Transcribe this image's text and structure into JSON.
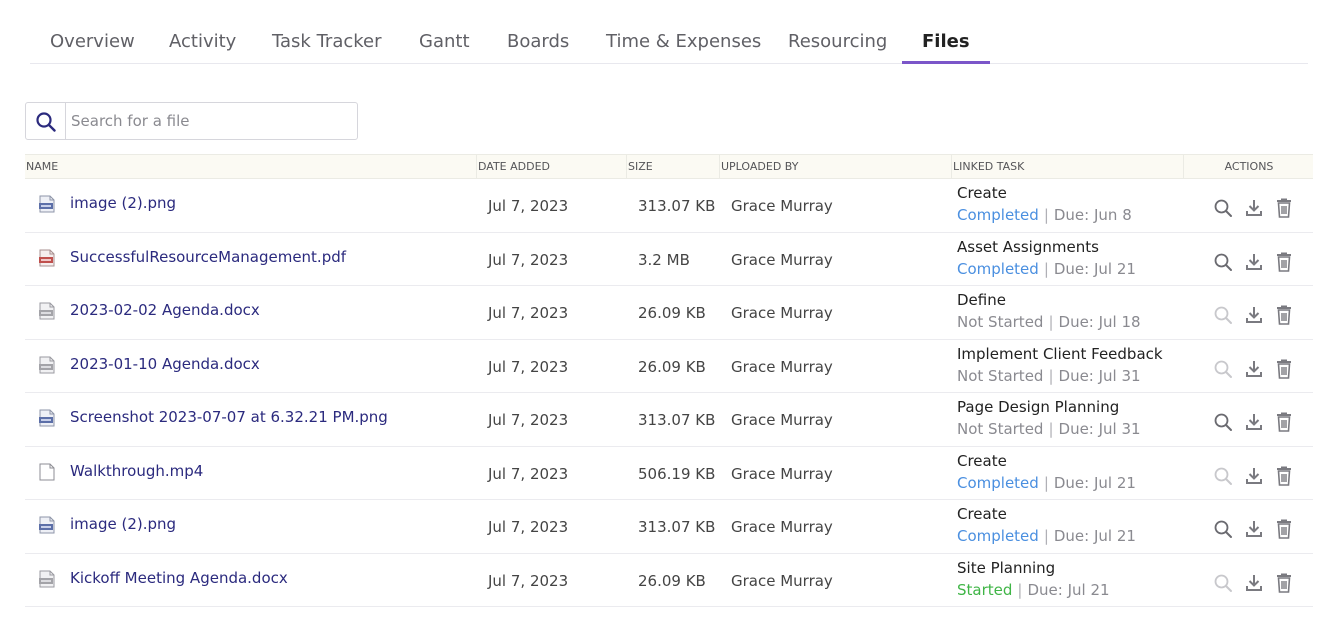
{
  "tabs": [
    {
      "label": "Overview",
      "active": false
    },
    {
      "label": "Activity",
      "active": false
    },
    {
      "label": "Task Tracker",
      "active": false
    },
    {
      "label": "Gantt",
      "active": false
    },
    {
      "label": "Boards",
      "active": false
    },
    {
      "label": "Time & Expenses",
      "active": false
    },
    {
      "label": "Resourcing",
      "active": false
    },
    {
      "label": "Files",
      "active": true
    }
  ],
  "search": {
    "placeholder": "Search for a file",
    "value": ""
  },
  "table": {
    "headers": {
      "name": "NAME",
      "date_added": "DATE ADDED",
      "size": "SIZE",
      "uploaded_by": "UPLOADED BY",
      "linked_task": "LINKED TASK",
      "actions": "ACTIONS"
    },
    "rows": [
      {
        "icon": "png-file-icon",
        "name": "image (2).png",
        "date": "Jul 7, 2023",
        "size": "313.07 KB",
        "uploader": "Grace Murray",
        "task": "Create",
        "status": "Completed",
        "status_kind": "completed",
        "due": "Due: Jun 8",
        "preview_enabled": true
      },
      {
        "icon": "pdf-file-icon",
        "name": "SuccessfulResourceManagement.pdf",
        "date": "Jul 7, 2023",
        "size": "3.2 MB",
        "uploader": "Grace Murray",
        "task": "Asset Assignments",
        "status": "Completed",
        "status_kind": "completed",
        "due": "Due: Jul 21",
        "preview_enabled": true
      },
      {
        "icon": "doc-file-icon",
        "name": "2023-02-02 Agenda.docx",
        "date": "Jul 7, 2023",
        "size": "26.09 KB",
        "uploader": "Grace Murray",
        "task": "Define",
        "status": "Not Started",
        "status_kind": "notstarted",
        "due": "Due: Jul 18",
        "preview_enabled": false
      },
      {
        "icon": "doc-file-icon",
        "name": "2023-01-10 Agenda.docx",
        "date": "Jul 7, 2023",
        "size": "26.09 KB",
        "uploader": "Grace Murray",
        "task": "Implement Client Feedback",
        "status": "Not Started",
        "status_kind": "notstarted",
        "due": "Due: Jul 31",
        "preview_enabled": false
      },
      {
        "icon": "png-file-icon",
        "name": "Screenshot 2023-07-07 at 6.32.21 PM.png",
        "date": "Jul 7, 2023",
        "size": "313.07 KB",
        "uploader": "Grace Murray",
        "task": "Page Design Planning",
        "status": "Not Started",
        "status_kind": "notstarted",
        "due": "Due: Jul 31",
        "preview_enabled": true
      },
      {
        "icon": "blank-file-icon",
        "name": "Walkthrough.mp4",
        "date": "Jul 7, 2023",
        "size": "506.19 KB",
        "uploader": "Grace Murray",
        "task": "Create",
        "status": "Completed",
        "status_kind": "completed",
        "due": "Due: Jul 21",
        "preview_enabled": false
      },
      {
        "icon": "png-file-icon",
        "name": "image (2).png",
        "date": "Jul 7, 2023",
        "size": "313.07 KB",
        "uploader": "Grace Murray",
        "task": "Create",
        "status": "Completed",
        "status_kind": "completed",
        "due": "Due: Jul 21",
        "preview_enabled": true
      },
      {
        "icon": "doc-file-icon",
        "name": "Kickoff Meeting Agenda.docx",
        "date": "Jul 7, 2023",
        "size": "26.09 KB",
        "uploader": "Grace Murray",
        "task": "Site Planning",
        "status": "Started",
        "status_kind": "started",
        "due": "Due: Jul 21",
        "preview_enabled": false
      }
    ]
  },
  "colors": {
    "accent": "#7b56c9",
    "link": "#2b2a7e",
    "completed": "#4a8fe0",
    "not_started": "#8a8a90",
    "started": "#3fb546"
  }
}
